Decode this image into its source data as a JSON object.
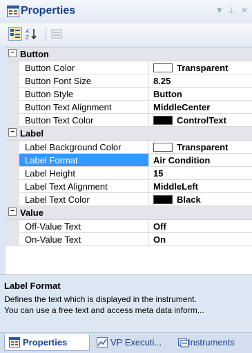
{
  "title": "Properties",
  "toolbar": {
    "buttons": [
      {
        "name": "categorized-icon",
        "active": true
      },
      {
        "name": "sort-alphabetical-icon",
        "active": false
      },
      {
        "name": "property-pages-icon",
        "active": false
      }
    ]
  },
  "categories": [
    {
      "label": "Button",
      "toggle": "−",
      "rows": [
        {
          "name": "Button Color",
          "value": "Transparent",
          "swatch": "white"
        },
        {
          "name": "Button Font Size",
          "value": "8.25"
        },
        {
          "name": "Button Style",
          "value": "Button"
        },
        {
          "name": "Button Text Alignment",
          "value": "MiddleCenter"
        },
        {
          "name": "Button Text Color",
          "value": "ControlText",
          "swatch": "black"
        }
      ]
    },
    {
      "label": "Label",
      "toggle": "−",
      "rows": [
        {
          "name": "Label Background Color",
          "value": "Transparent",
          "swatch": "white"
        },
        {
          "name": "Label Format",
          "value": "Air Condition",
          "selected": true
        },
        {
          "name": "Label Height",
          "value": "15"
        },
        {
          "name": "Label Text Alignment",
          "value": "MiddleLeft"
        },
        {
          "name": "Label Text Color",
          "value": "Black",
          "swatch": "black"
        }
      ]
    },
    {
      "label": "Value",
      "toggle": "−",
      "rows": [
        {
          "name": "Off-Value Text",
          "value": "Off"
        },
        {
          "name": "On-Value Text",
          "value": "On"
        }
      ]
    }
  ],
  "help": {
    "title": "Label Format",
    "line1": "Defines the text which is displayed in the instrument.",
    "line2": "You can use a free text and access meta data inform..."
  },
  "tabs": [
    {
      "label": "Properties",
      "active": true
    },
    {
      "label": "VP Executi...",
      "active": false
    },
    {
      "label": "Instruments",
      "active": false
    }
  ]
}
